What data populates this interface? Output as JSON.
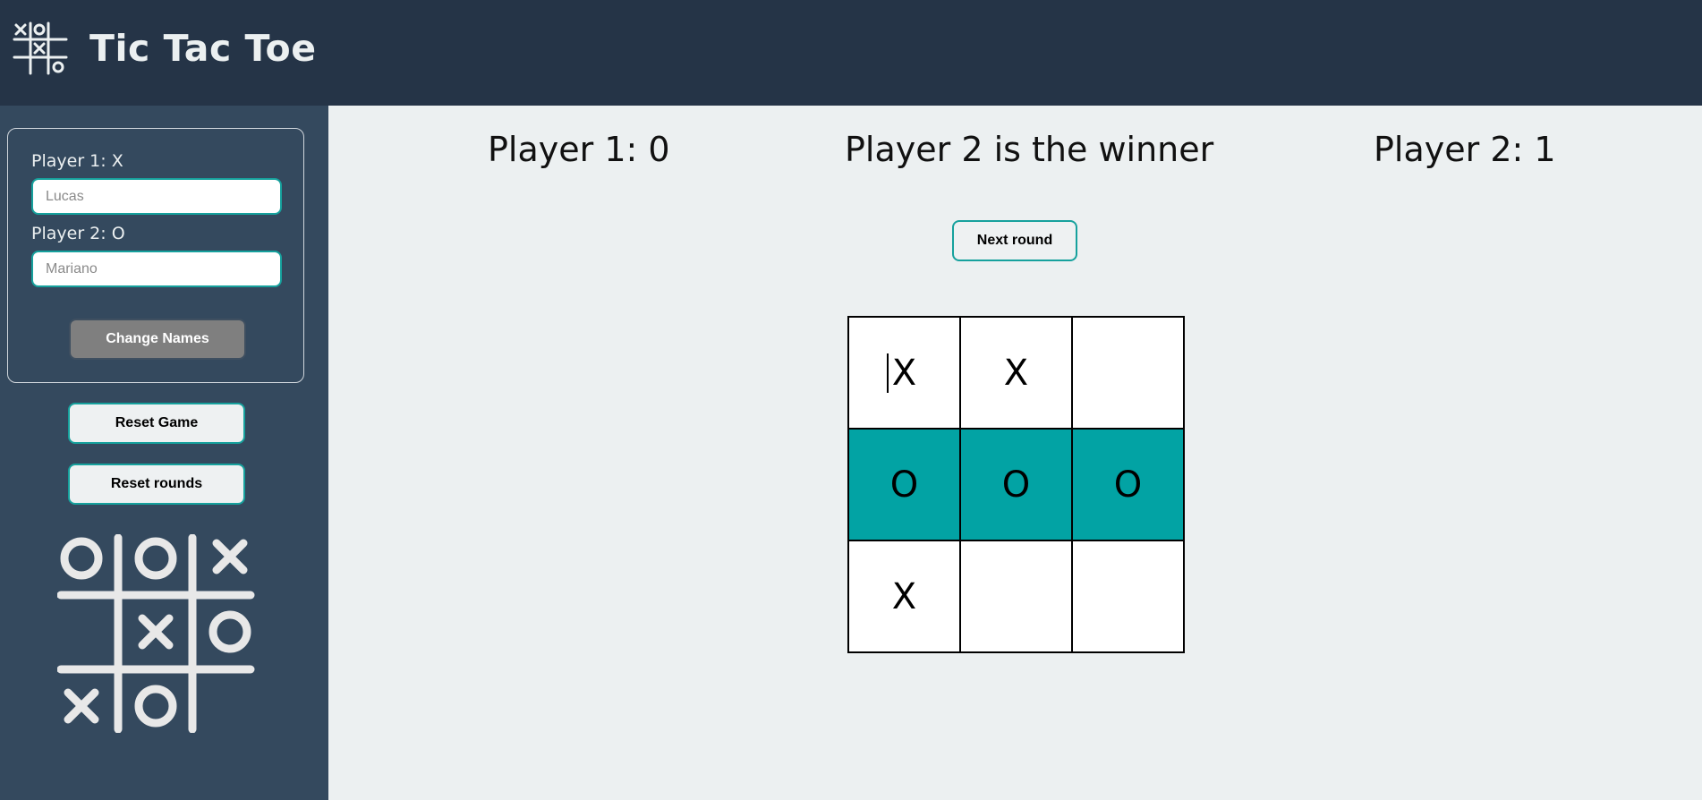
{
  "header": {
    "title": "Tic Tac Toe",
    "logo_icon": "tic-tac-toe-logo-icon"
  },
  "sidebar": {
    "player1_label": "Player 1: X",
    "player1_placeholder": "Lucas",
    "player2_label": "Player 2: O",
    "player2_placeholder": "Mariano",
    "change_names_label": "Change Names",
    "reset_game_label": "Reset Game",
    "reset_rounds_label": "Reset rounds",
    "decoration_icon": "tic-tac-toe-illustration-icon"
  },
  "scoreboard": {
    "player1_score": "Player 1: 0",
    "status": "Player 2 is the winner",
    "player2_score": "Player 2: 1"
  },
  "next_round_label": "Next round",
  "board": {
    "cells": [
      "X",
      "X",
      "",
      "O",
      "O",
      "O",
      "X",
      "",
      ""
    ],
    "winning_cells": [
      3,
      4,
      5
    ],
    "winning_color": "#02a3a4"
  },
  "colors": {
    "header_bg": "#253447",
    "sidebar_bg": "#34495e",
    "main_bg": "#ecf0f1",
    "accent": "#16a19d"
  }
}
